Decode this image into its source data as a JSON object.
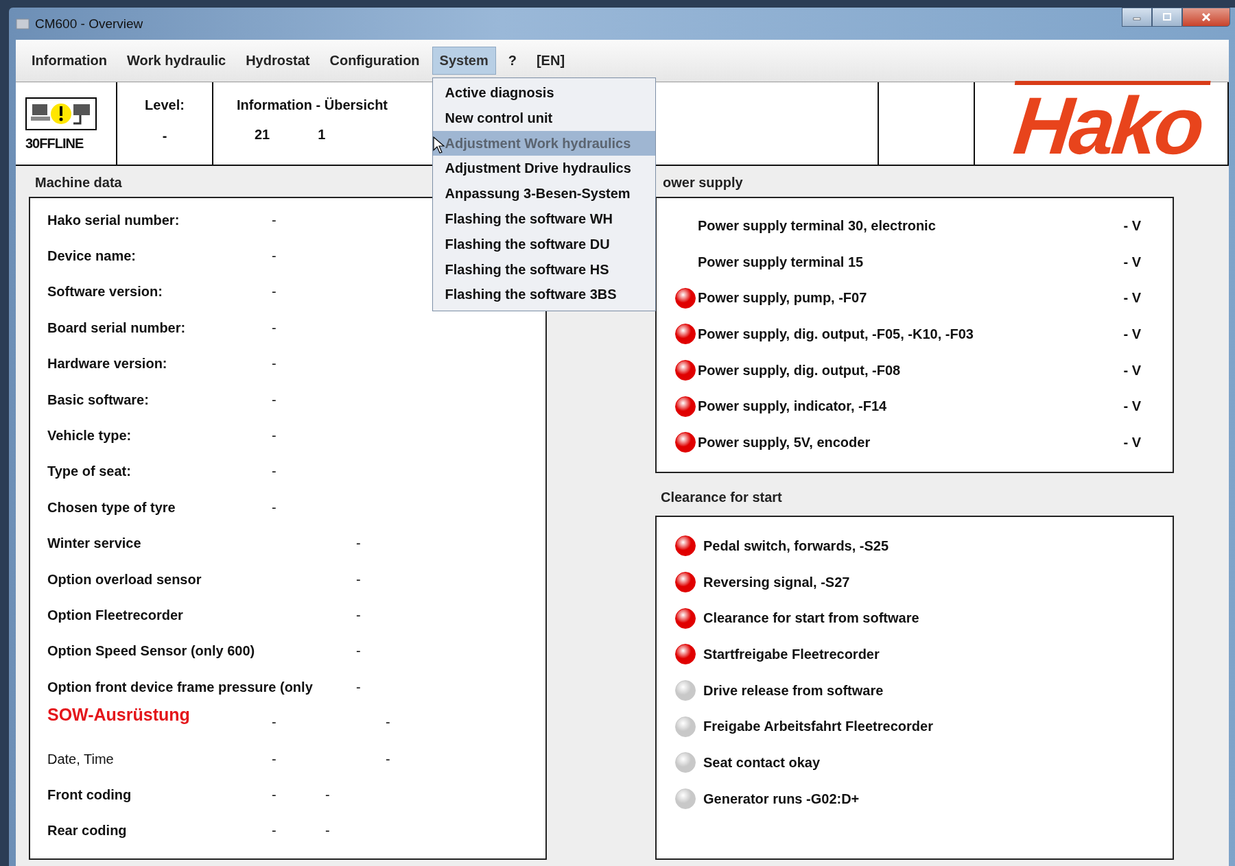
{
  "window": {
    "title": "CM600 - Overview"
  },
  "menu": [
    {
      "label": "Information",
      "selected": false
    },
    {
      "label": "Work hydraulic",
      "selected": false
    },
    {
      "label": "Hydrostat",
      "selected": false
    },
    {
      "label": "Configuration",
      "selected": false
    },
    {
      "label": "System",
      "selected": true
    },
    {
      "label": "?",
      "selected": false
    },
    {
      "label": "[EN]",
      "selected": false
    }
  ],
  "dropdown": [
    {
      "label": "Active diagnosis",
      "selected": false,
      "disabled": false
    },
    {
      "label": "New control unit",
      "selected": false,
      "disabled": false
    },
    {
      "label": "Adjustment Work hydraulics",
      "selected": true,
      "disabled": true
    },
    {
      "label": "Adjustment Drive hydraulics",
      "selected": false,
      "disabled": false
    },
    {
      "label": "Anpassung 3-Besen-System",
      "selected": false,
      "disabled": false
    },
    {
      "label": "Flashing the software WH",
      "selected": false,
      "disabled": false
    },
    {
      "label": "Flashing the software DU",
      "selected": false,
      "disabled": false
    },
    {
      "label": "Flashing the software HS",
      "selected": false,
      "disabled": false
    },
    {
      "label": "Flashing the software 3BS",
      "selected": false,
      "disabled": false
    }
  ],
  "header": {
    "status": "30FFLINE",
    "level_label": "Level:",
    "level_value": "-",
    "info_title": "Information - Übersicht",
    "info_values": [
      "21",
      "1"
    ],
    "logo": "Hako"
  },
  "machine_data": {
    "title": "Machine data",
    "rows": [
      {
        "kind": "basic",
        "label": "Hako serial number:",
        "values": [
          "-"
        ]
      },
      {
        "kind": "basic",
        "label": "Device name:",
        "values": [
          "-"
        ]
      },
      {
        "kind": "basic",
        "label": "Software version:",
        "values": [
          "-"
        ]
      },
      {
        "kind": "basic",
        "label": "Board serial number:",
        "values": [
          "-"
        ]
      },
      {
        "kind": "basic",
        "label": "Hardware version:",
        "values": [
          "-"
        ]
      },
      {
        "kind": "basic",
        "label": "Basic software:",
        "values": [
          "-"
        ]
      },
      {
        "kind": "basic",
        "label": "Vehicle type:",
        "values": [
          "-"
        ]
      },
      {
        "kind": "basic",
        "label": "Type of seat:",
        "values": [
          "-"
        ]
      },
      {
        "kind": "basic",
        "label": "Chosen type of tyre",
        "values": [
          "-"
        ]
      },
      {
        "kind": "option",
        "label": "Winter service",
        "values": [
          "-"
        ]
      },
      {
        "kind": "option",
        "label": "Option overload sensor",
        "values": [
          "-"
        ]
      },
      {
        "kind": "option",
        "label": "Option Fleetrecorder",
        "values": [
          "-"
        ]
      },
      {
        "kind": "option",
        "label": "Option Speed Sensor (only 600)",
        "values": [
          "-"
        ]
      },
      {
        "kind": "option",
        "label": "Option front device frame pressure (only",
        "values": [
          "-"
        ]
      },
      {
        "kind": "heading",
        "label": "SOW-Ausrüstung",
        "values": [
          "-",
          "-"
        ]
      },
      {
        "kind": "pair",
        "label": "Date, Time",
        "values": [
          "-",
          "-"
        ]
      },
      {
        "kind": "coding",
        "label": "Front coding",
        "values": [
          "-",
          "-"
        ]
      },
      {
        "kind": "coding",
        "label": "Rear coding",
        "values": [
          "-",
          "-"
        ]
      }
    ]
  },
  "power_supply": {
    "title": "ower supply",
    "rows": [
      {
        "label": "Power supply terminal 30, electronic",
        "value": "- V"
      },
      {
        "label": "Power supply terminal 15",
        "value": "- V"
      },
      {
        "label": "Power supply, pump, -F07",
        "value": "- V",
        "color": "#e00000"
      },
      {
        "label": "Power supply, dig. output, -F05, -K10, -F03",
        "value": "- V",
        "color": "#e00000"
      },
      {
        "label": "Power supply, dig. output, -F08",
        "value": "- V",
        "color": "#e00000"
      },
      {
        "label": "Power supply, indicator, -F14",
        "value": "- V",
        "color": "#e00000"
      },
      {
        "label": "Power supply, 5V, encoder",
        "value": "- V",
        "color": "#e00000"
      }
    ]
  },
  "clearance": {
    "title": "Clearance for start",
    "rows": [
      {
        "label": "Pedal switch, forwards, -S25",
        "color": "#e00000"
      },
      {
        "label": "Reversing signal, -S27",
        "color": "#e00000"
      },
      {
        "label": "Clearance for start from software",
        "color": "#e00000"
      },
      {
        "label": "Startfreigabe Fleetrecorder",
        "color": "#e00000"
      },
      {
        "label": "Drive release from software",
        "color": "#c8c8c8"
      },
      {
        "label": "Freigabe Arbeitsfahrt Fleetrecorder",
        "color": "#c8c8c8"
      },
      {
        "label": "Seat contact okay",
        "color": "#c8c8c8"
      },
      {
        "label": "Generator runs -G02:D+",
        "color": "#c8c8c8"
      }
    ]
  }
}
